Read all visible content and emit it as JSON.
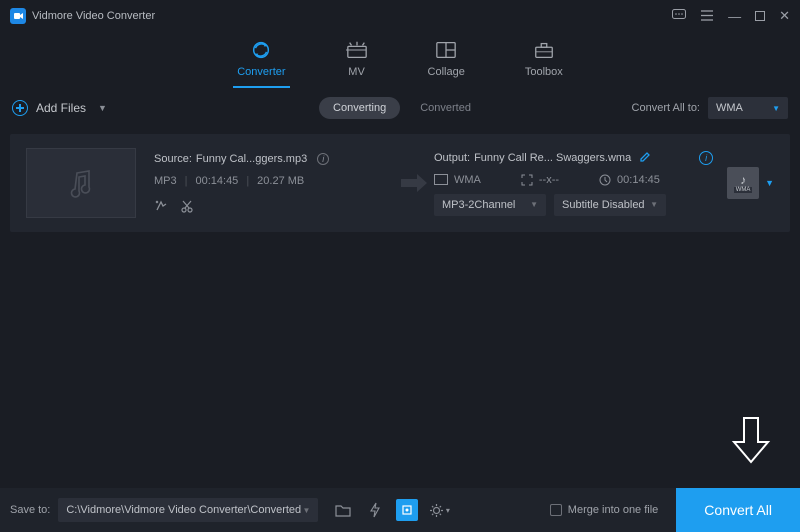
{
  "app": {
    "title": "Vidmore Video Converter"
  },
  "top_tabs": {
    "converter": "Converter",
    "mv": "MV",
    "collage": "Collage",
    "toolbox": "Toolbox"
  },
  "add_files_label": "Add Files",
  "status_tabs": {
    "converting": "Converting",
    "converted": "Converted"
  },
  "convert_all_to": {
    "label": "Convert All to:",
    "value": "WMA"
  },
  "item": {
    "source_prefix": "Source:",
    "source_name": "Funny Cal...ggers.mp3",
    "format": "MP3",
    "duration": "00:14:45",
    "size": "20.27 MB",
    "output_prefix": "Output:",
    "output_name": "Funny Call Re... Swaggers.wma",
    "out_format": "WMA",
    "resolution": "--x--",
    "out_duration": "00:14:45",
    "audio_codec": "MP3-2Channel",
    "subtitle": "Subtitle Disabled",
    "thumb_fmt": "WMA"
  },
  "bottom": {
    "save_to_label": "Save to:",
    "path": "C:\\Vidmore\\Vidmore Video Converter\\Converted",
    "merge_label": "Merge into one file",
    "convert_btn": "Convert All"
  }
}
